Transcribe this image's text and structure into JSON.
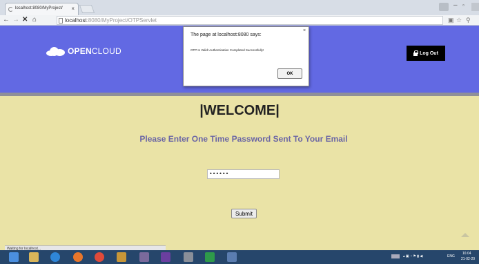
{
  "browser": {
    "tab_title": "localhost:8080/MyProject/",
    "tab_close": "×",
    "url_host": "localhost",
    "url_rest": ":8080/MyProject/OTPServlet",
    "nav": {
      "back": "←",
      "forward": "→",
      "stop": "✕",
      "home": "⌂"
    }
  },
  "header": {
    "logo_bold": "OPEN",
    "logo_light": "CLOUD",
    "logout_label": "Log Out"
  },
  "alert": {
    "title": "The page at localhost:8080 says:",
    "close": "×",
    "message": "OTP Is Valid! Authentication Completed Successfully!",
    "ok_label": "OK"
  },
  "main": {
    "welcome": "|WELCOME|",
    "prompt": "Please Enter One Time Password Sent To Your Email",
    "otp_value": "••••••",
    "submit_label": "Submit"
  },
  "status": {
    "text": "Waiting for localhost..."
  },
  "taskbar": {
    "lang": "ENG",
    "time": "16:04",
    "date": "21-02-20"
  },
  "colors": {
    "header": "#6269e3",
    "page": "#eae3a6",
    "prompt": "#6b66a5",
    "taskbar": "#26466b"
  }
}
